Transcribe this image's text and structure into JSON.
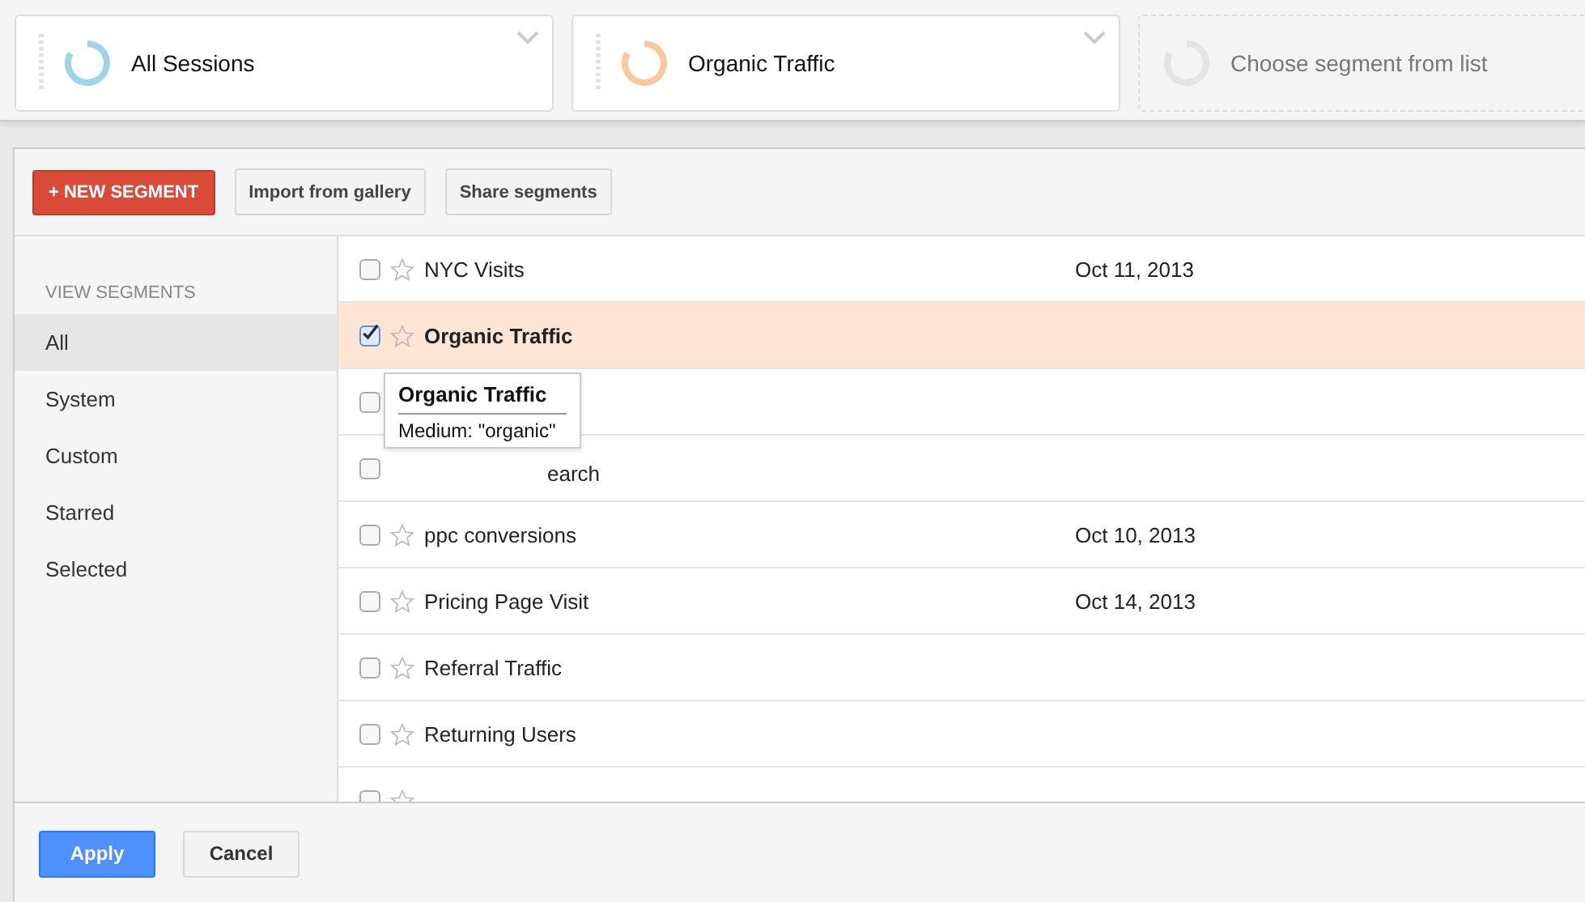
{
  "segments": [
    {
      "label": "All Sessions",
      "kind": "chosen",
      "color": "#9fd3ea"
    },
    {
      "label": "Organic Traffic",
      "kind": "chosen",
      "color": "#f8c9a0"
    },
    {
      "label": "Choose segment from list",
      "kind": "empty",
      "color": "#e4e4e4"
    }
  ],
  "toolbar": {
    "new_segment": "+ NEW SEGMENT",
    "buttons": [
      "Import from gallery",
      "Share segments"
    ]
  },
  "sidebar": {
    "heading": "VIEW SEGMENTS",
    "items": [
      {
        "label": "All",
        "selected": true
      },
      {
        "label": "System",
        "selected": false
      },
      {
        "label": "Custom",
        "selected": false
      },
      {
        "label": "Starred",
        "selected": false
      },
      {
        "label": "Selected",
        "selected": false
      }
    ]
  },
  "rows": [
    {
      "kind": "full",
      "label": "NYC Visits",
      "date": "Oct 11, 2013",
      "checked": false,
      "selected": false
    },
    {
      "kind": "full",
      "label": "Organic Traffic",
      "checked": true,
      "selected": true
    },
    {
      "kind": "hidden",
      "checked": false,
      "selected": false
    },
    {
      "kind": "covered",
      "label": "earch",
      "checked": false,
      "selected": false
    },
    {
      "kind": "full",
      "label": "ppc conversions",
      "date": "Oct 10, 2013",
      "checked": false,
      "selected": false
    },
    {
      "kind": "full",
      "label": "Pricing Page Visit",
      "date": "Oct 14, 2013",
      "checked": false,
      "selected": false
    },
    {
      "kind": "full",
      "label": "Referral Traffic",
      "checked": false,
      "selected": false
    },
    {
      "kind": "full",
      "label": "Returning Users",
      "checked": false,
      "selected": false
    },
    {
      "kind": "stub",
      "checked": false,
      "selected": false
    }
  ],
  "tooltip": {
    "title": "Organic Traffic",
    "body": "Medium: \"organic\""
  },
  "footer": {
    "apply": "Apply",
    "cancel": "Cancel"
  }
}
